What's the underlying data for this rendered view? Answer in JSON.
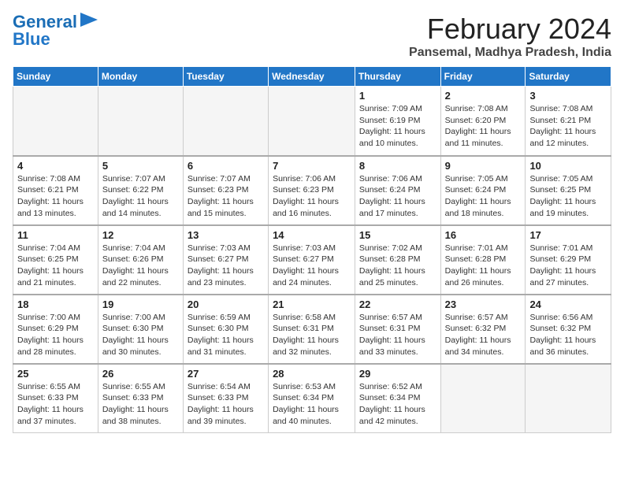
{
  "logo": {
    "line1": "General",
    "line2": "Blue"
  },
  "header": {
    "month_year": "February 2024",
    "location": "Pansemal, Madhya Pradesh, India"
  },
  "weekdays": [
    "Sunday",
    "Monday",
    "Tuesday",
    "Wednesday",
    "Thursday",
    "Friday",
    "Saturday"
  ],
  "weeks": [
    [
      {
        "day": "",
        "info": ""
      },
      {
        "day": "",
        "info": ""
      },
      {
        "day": "",
        "info": ""
      },
      {
        "day": "",
        "info": ""
      },
      {
        "day": "1",
        "info": "Sunrise: 7:09 AM\nSunset: 6:19 PM\nDaylight: 11 hours\nand 10 minutes."
      },
      {
        "day": "2",
        "info": "Sunrise: 7:08 AM\nSunset: 6:20 PM\nDaylight: 11 hours\nand 11 minutes."
      },
      {
        "day": "3",
        "info": "Sunrise: 7:08 AM\nSunset: 6:21 PM\nDaylight: 11 hours\nand 12 minutes."
      }
    ],
    [
      {
        "day": "4",
        "info": "Sunrise: 7:08 AM\nSunset: 6:21 PM\nDaylight: 11 hours\nand 13 minutes."
      },
      {
        "day": "5",
        "info": "Sunrise: 7:07 AM\nSunset: 6:22 PM\nDaylight: 11 hours\nand 14 minutes."
      },
      {
        "day": "6",
        "info": "Sunrise: 7:07 AM\nSunset: 6:23 PM\nDaylight: 11 hours\nand 15 minutes."
      },
      {
        "day": "7",
        "info": "Sunrise: 7:06 AM\nSunset: 6:23 PM\nDaylight: 11 hours\nand 16 minutes."
      },
      {
        "day": "8",
        "info": "Sunrise: 7:06 AM\nSunset: 6:24 PM\nDaylight: 11 hours\nand 17 minutes."
      },
      {
        "day": "9",
        "info": "Sunrise: 7:05 AM\nSunset: 6:24 PM\nDaylight: 11 hours\nand 18 minutes."
      },
      {
        "day": "10",
        "info": "Sunrise: 7:05 AM\nSunset: 6:25 PM\nDaylight: 11 hours\nand 19 minutes."
      }
    ],
    [
      {
        "day": "11",
        "info": "Sunrise: 7:04 AM\nSunset: 6:25 PM\nDaylight: 11 hours\nand 21 minutes."
      },
      {
        "day": "12",
        "info": "Sunrise: 7:04 AM\nSunset: 6:26 PM\nDaylight: 11 hours\nand 22 minutes."
      },
      {
        "day": "13",
        "info": "Sunrise: 7:03 AM\nSunset: 6:27 PM\nDaylight: 11 hours\nand 23 minutes."
      },
      {
        "day": "14",
        "info": "Sunrise: 7:03 AM\nSunset: 6:27 PM\nDaylight: 11 hours\nand 24 minutes."
      },
      {
        "day": "15",
        "info": "Sunrise: 7:02 AM\nSunset: 6:28 PM\nDaylight: 11 hours\nand 25 minutes."
      },
      {
        "day": "16",
        "info": "Sunrise: 7:01 AM\nSunset: 6:28 PM\nDaylight: 11 hours\nand 26 minutes."
      },
      {
        "day": "17",
        "info": "Sunrise: 7:01 AM\nSunset: 6:29 PM\nDaylight: 11 hours\nand 27 minutes."
      }
    ],
    [
      {
        "day": "18",
        "info": "Sunrise: 7:00 AM\nSunset: 6:29 PM\nDaylight: 11 hours\nand 28 minutes."
      },
      {
        "day": "19",
        "info": "Sunrise: 7:00 AM\nSunset: 6:30 PM\nDaylight: 11 hours\nand 30 minutes."
      },
      {
        "day": "20",
        "info": "Sunrise: 6:59 AM\nSunset: 6:30 PM\nDaylight: 11 hours\nand 31 minutes."
      },
      {
        "day": "21",
        "info": "Sunrise: 6:58 AM\nSunset: 6:31 PM\nDaylight: 11 hours\nand 32 minutes."
      },
      {
        "day": "22",
        "info": "Sunrise: 6:57 AM\nSunset: 6:31 PM\nDaylight: 11 hours\nand 33 minutes."
      },
      {
        "day": "23",
        "info": "Sunrise: 6:57 AM\nSunset: 6:32 PM\nDaylight: 11 hours\nand 34 minutes."
      },
      {
        "day": "24",
        "info": "Sunrise: 6:56 AM\nSunset: 6:32 PM\nDaylight: 11 hours\nand 36 minutes."
      }
    ],
    [
      {
        "day": "25",
        "info": "Sunrise: 6:55 AM\nSunset: 6:33 PM\nDaylight: 11 hours\nand 37 minutes."
      },
      {
        "day": "26",
        "info": "Sunrise: 6:55 AM\nSunset: 6:33 PM\nDaylight: 11 hours\nand 38 minutes."
      },
      {
        "day": "27",
        "info": "Sunrise: 6:54 AM\nSunset: 6:33 PM\nDaylight: 11 hours\nand 39 minutes."
      },
      {
        "day": "28",
        "info": "Sunrise: 6:53 AM\nSunset: 6:34 PM\nDaylight: 11 hours\nand 40 minutes."
      },
      {
        "day": "29",
        "info": "Sunrise: 6:52 AM\nSunset: 6:34 PM\nDaylight: 11 hours\nand 42 minutes."
      },
      {
        "day": "",
        "info": ""
      },
      {
        "day": "",
        "info": ""
      }
    ]
  ]
}
